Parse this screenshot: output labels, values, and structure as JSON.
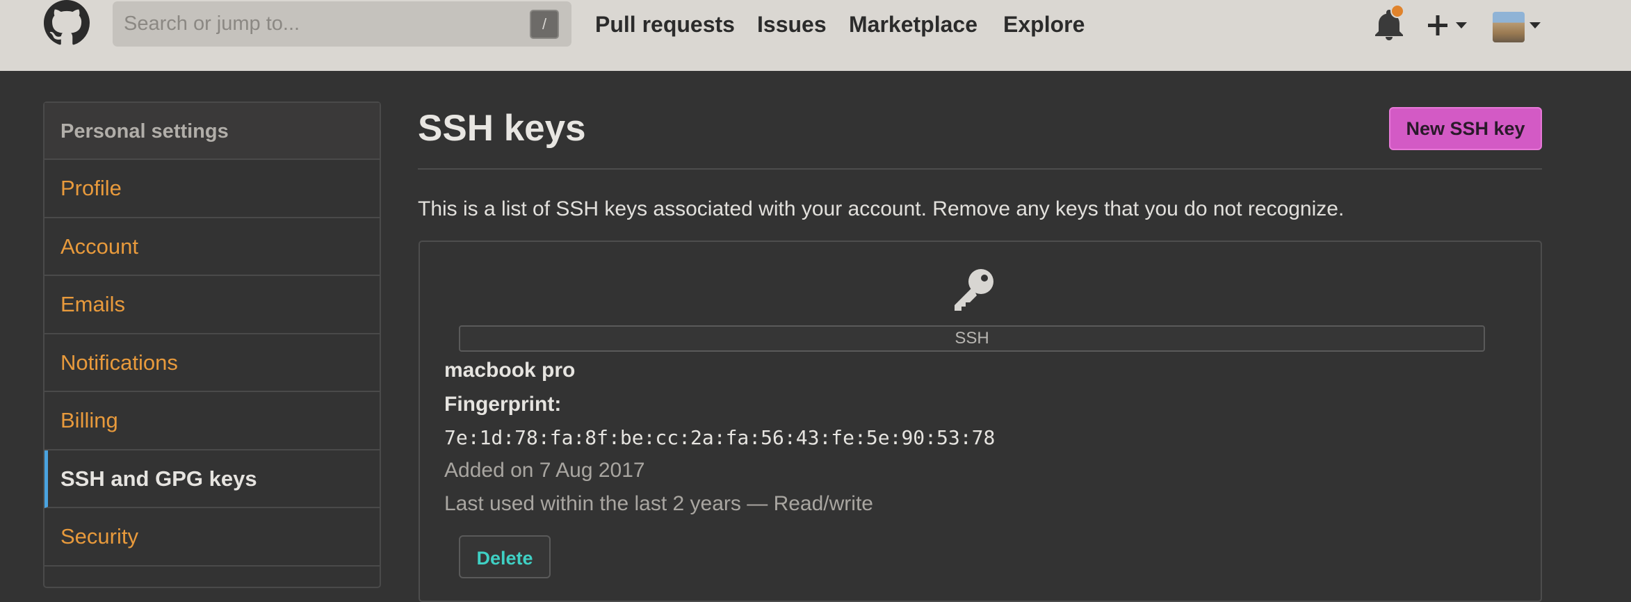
{
  "header": {
    "search": {
      "placeholder": "Search or jump to...",
      "shortcut": "/"
    },
    "nav": [
      "Pull requests",
      "Issues",
      "Marketplace",
      "Explore"
    ],
    "icons": [
      "github-logo-icon",
      "bell-icon",
      "plus-icon",
      "caret-down-icon",
      "avatar"
    ],
    "notification_dot_color": "#e0832c"
  },
  "sidebar": {
    "heading": "Personal settings",
    "items": [
      {
        "label": "Profile",
        "active": false
      },
      {
        "label": "Account",
        "active": false
      },
      {
        "label": "Emails",
        "active": false
      },
      {
        "label": "Notifications",
        "active": false
      },
      {
        "label": "Billing",
        "active": false
      },
      {
        "label": "SSH and GPG keys",
        "active": true
      },
      {
        "label": "Security",
        "active": false
      }
    ],
    "link_color": "#e89a3c",
    "active_marker_color": "#4aa3df"
  },
  "main": {
    "title": "SSH keys",
    "new_key_button": "New SSH key",
    "new_key_button_color": "#d35ac5",
    "intro": "This is a list of SSH keys associated with your account. Remove any keys that you do not recognize.",
    "key": {
      "icon": "key-icon",
      "type_badge": "SSH",
      "title": "macbook pro",
      "fingerprint_label": "Fingerprint:",
      "fingerprint": "7e:1d:78:fa:8f:be:cc:2a:fa:56:43:fe:5e:90:53:78",
      "added": "Added on 7 Aug 2017",
      "last_used": "Last used within the last 2 years — Read/write",
      "delete_button": "Delete",
      "delete_color": "#3fd0c4"
    }
  }
}
